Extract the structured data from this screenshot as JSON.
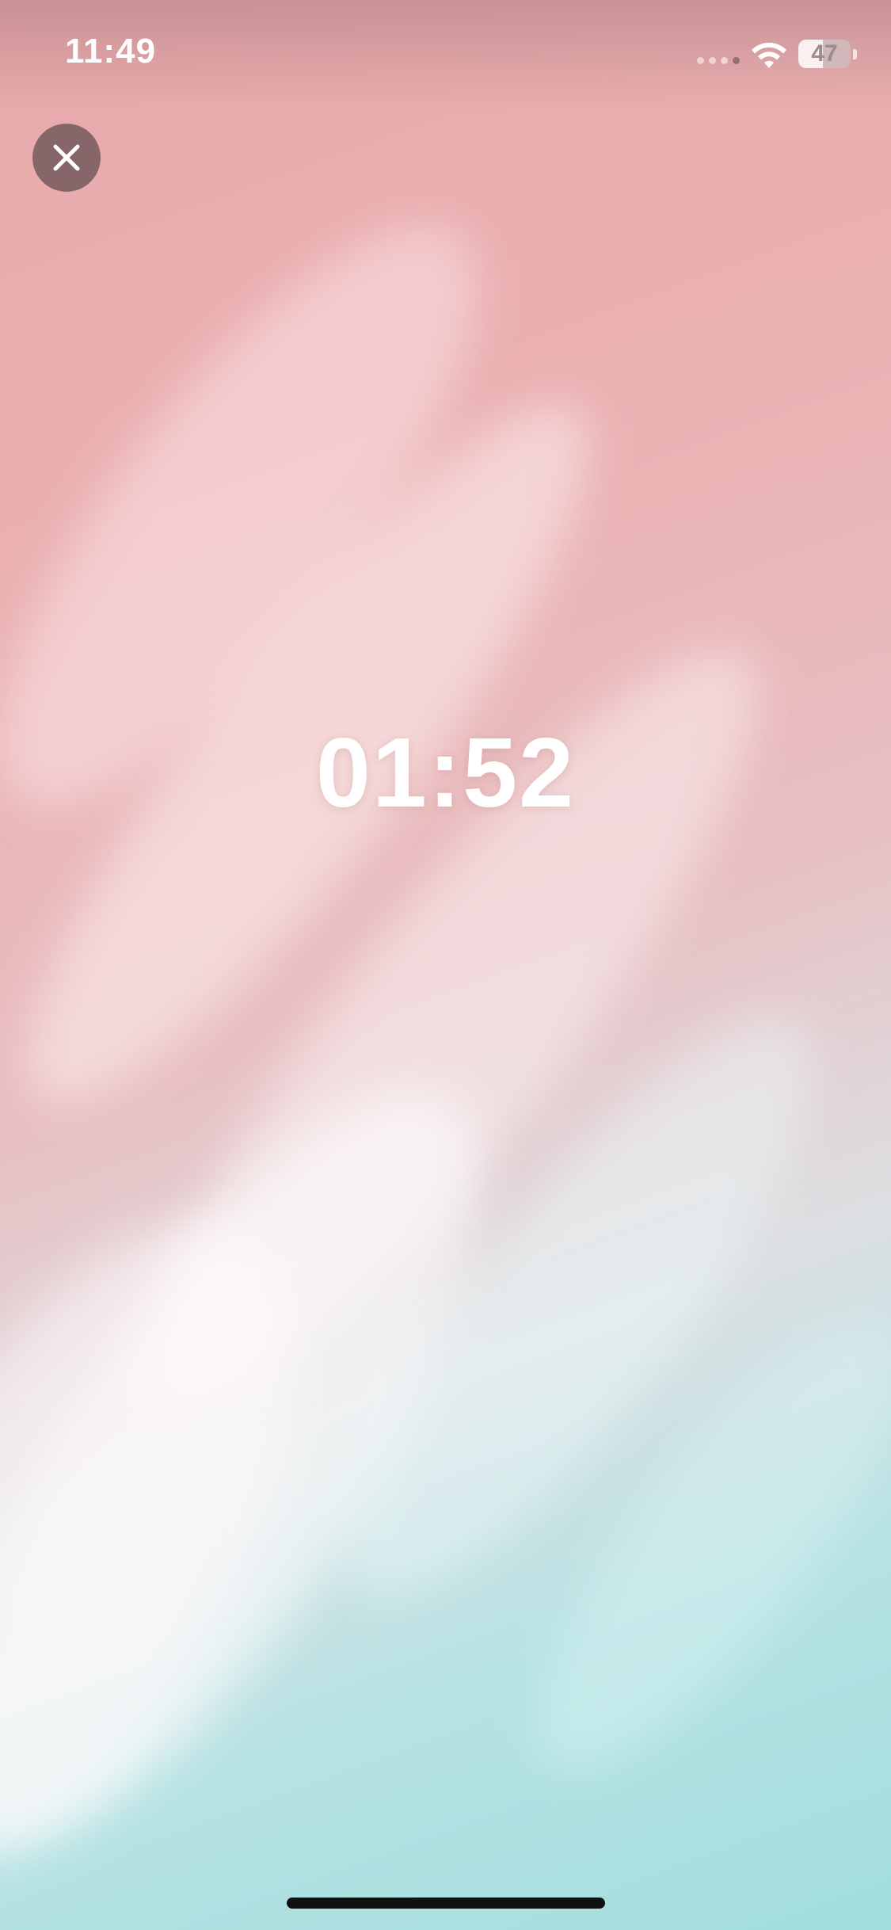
{
  "status_bar": {
    "time": "11:49",
    "battery_percent": "47",
    "battery_level": 0.47,
    "wifi_icon": "wifi-icon",
    "cellular_icon": "cellular-signal-icon"
  },
  "controls": {
    "close_icon": "close-icon"
  },
  "timer": {
    "display": "01:52"
  },
  "colors": {
    "timer_text": "#ffffff",
    "close_button_bg": "#5f4b4e",
    "gradient_top": "#e9a9ab",
    "gradient_bottom": "#a2dedd"
  }
}
